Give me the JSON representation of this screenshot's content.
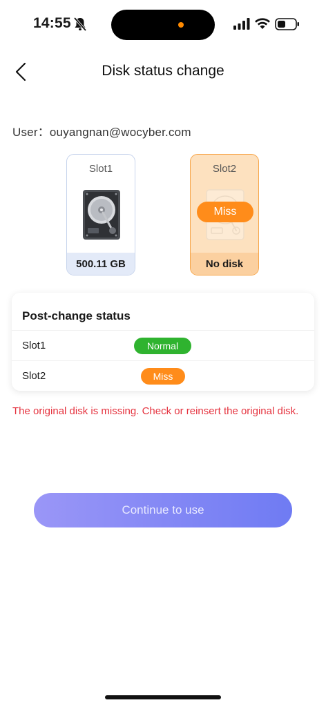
{
  "status_bar": {
    "time": "14:55"
  },
  "header": {
    "title": "Disk status change"
  },
  "user_line": "User：ouyangnan@wocyber.com",
  "slots": [
    {
      "label": "Slot1",
      "footer": "500.11 GB"
    },
    {
      "label": "Slot2",
      "footer": "No disk",
      "badge": "Miss"
    }
  ],
  "status_card": {
    "title": "Post-change status",
    "rows": [
      {
        "label": "Slot1",
        "status": "Normal",
        "color": "#2fb32f"
      },
      {
        "label": "Slot2",
        "status": "Miss",
        "color": "#ff8c1a"
      }
    ]
  },
  "error_message": "The original disk is missing. Check or reinsert the original disk.",
  "continue_button": "Continue to use",
  "colors": {
    "accent": "#7b80f5",
    "error": "#e5323e",
    "warning": "#ff8c1a",
    "success": "#2fb32f"
  }
}
